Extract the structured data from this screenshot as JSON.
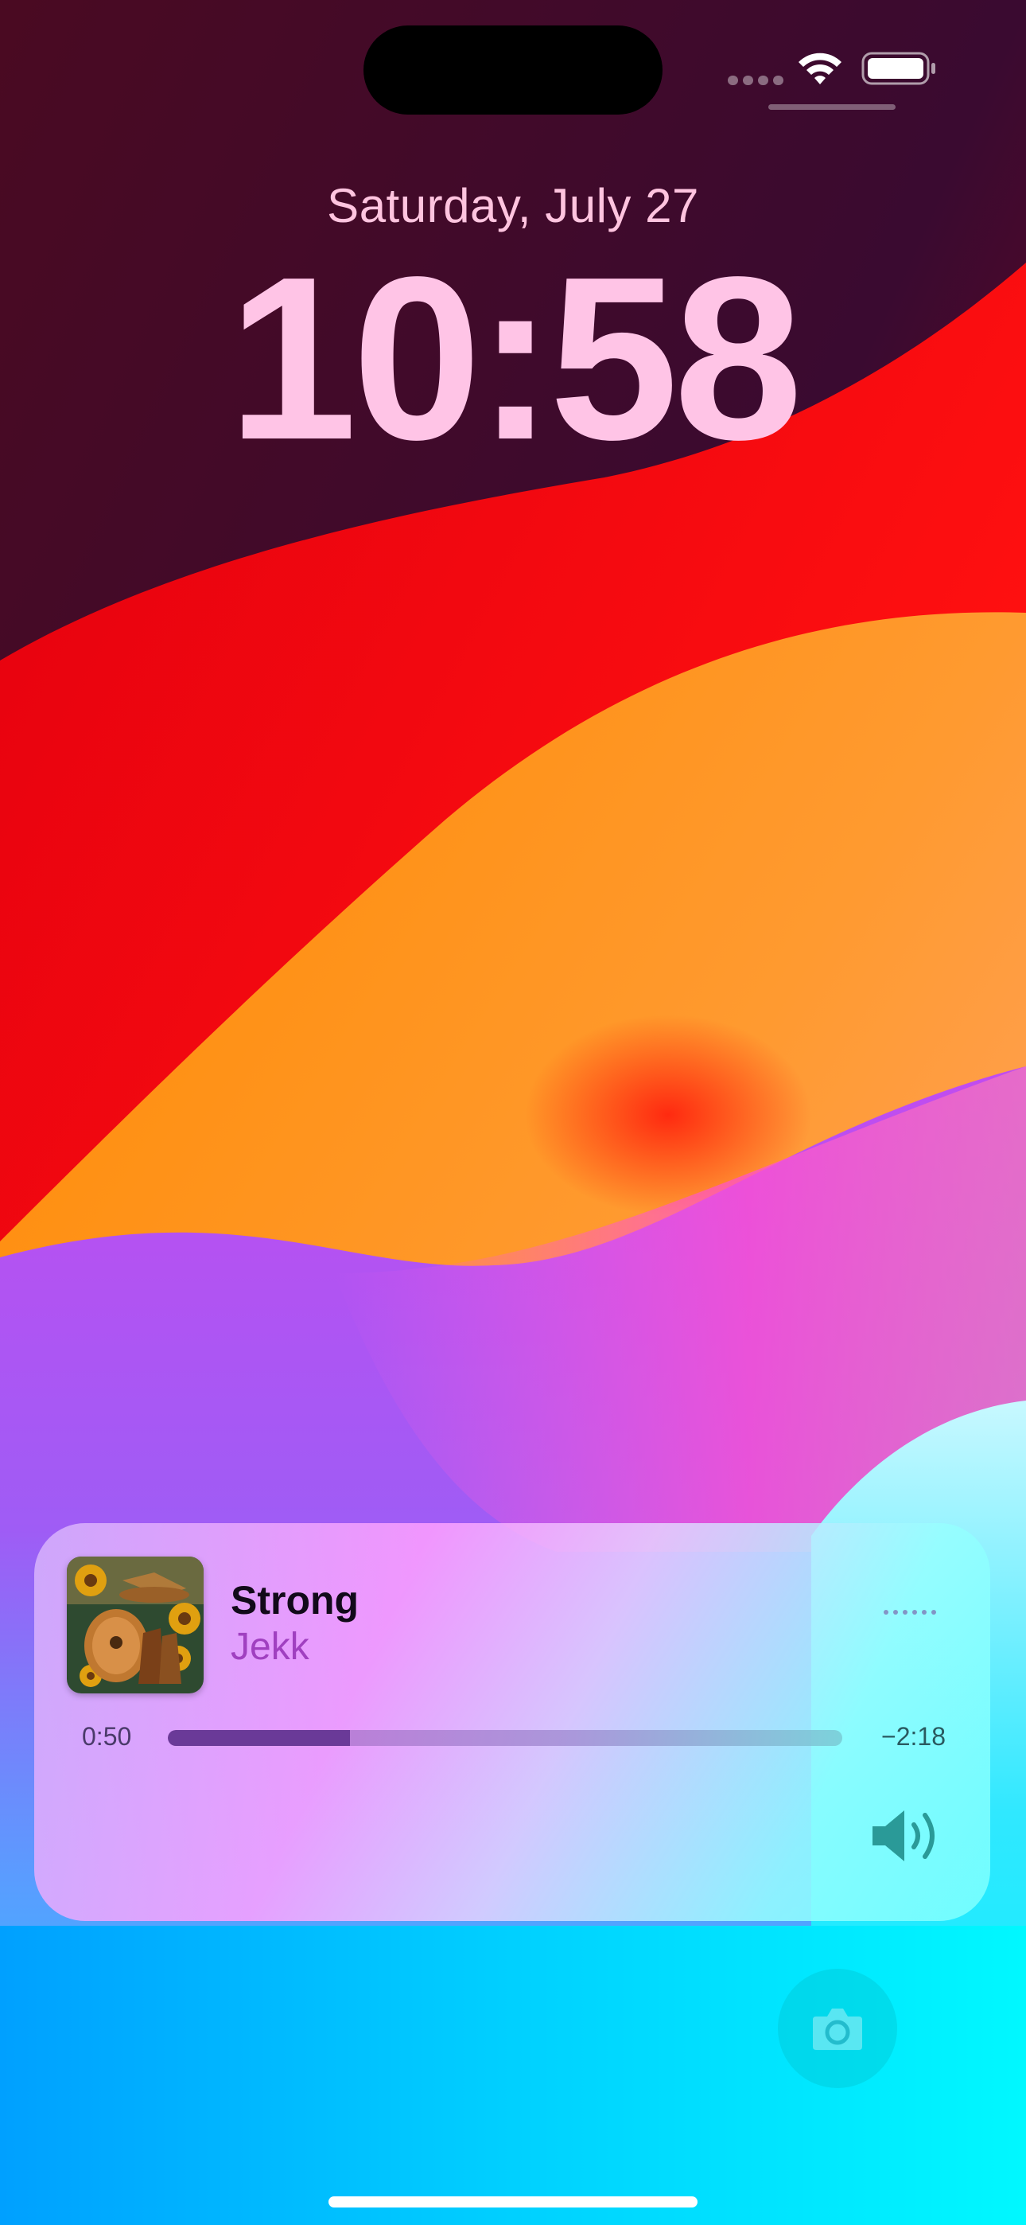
{
  "lock_screen": {
    "date": "Saturday, July 27",
    "time": "10:58"
  },
  "status_bar": {
    "wifi_icon": "wifi-icon",
    "battery_icon": "battery-icon"
  },
  "now_playing": {
    "title": "Strong",
    "artist": "Jekk",
    "elapsed": "0:50",
    "remaining": "−2:18",
    "progress_fraction": 0.27,
    "album_art_icon": "album-art",
    "more_icon": "more-dots-icon",
    "volume_icon": "speaker-volume-icon"
  },
  "camera": {
    "icon": "camera-icon"
  },
  "colors": {
    "date_time": "#ffc4e6",
    "artist": "#a040c0",
    "progress_fill": "#6a3a98"
  }
}
